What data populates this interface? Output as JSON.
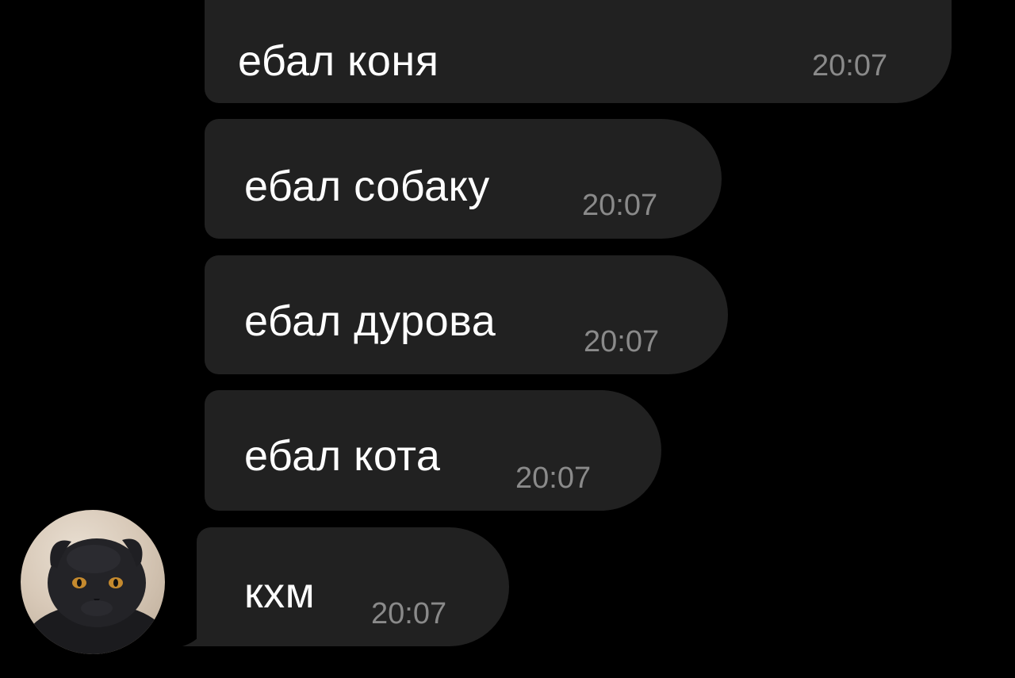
{
  "messages": [
    {
      "text": "ебал коня",
      "time": "20:07"
    },
    {
      "text": "ебал собаку",
      "time": "20:07"
    },
    {
      "text": "ебал дурова",
      "time": "20:07"
    },
    {
      "text": "ебал кота",
      "time": "20:07"
    },
    {
      "text": "кхм",
      "time": "20:07"
    }
  ],
  "avatar": {
    "icon": "cat-avatar"
  },
  "colors": {
    "background": "#000000",
    "bubble": "#212121",
    "text": "#ffffff",
    "time": "#8a8a8a"
  }
}
